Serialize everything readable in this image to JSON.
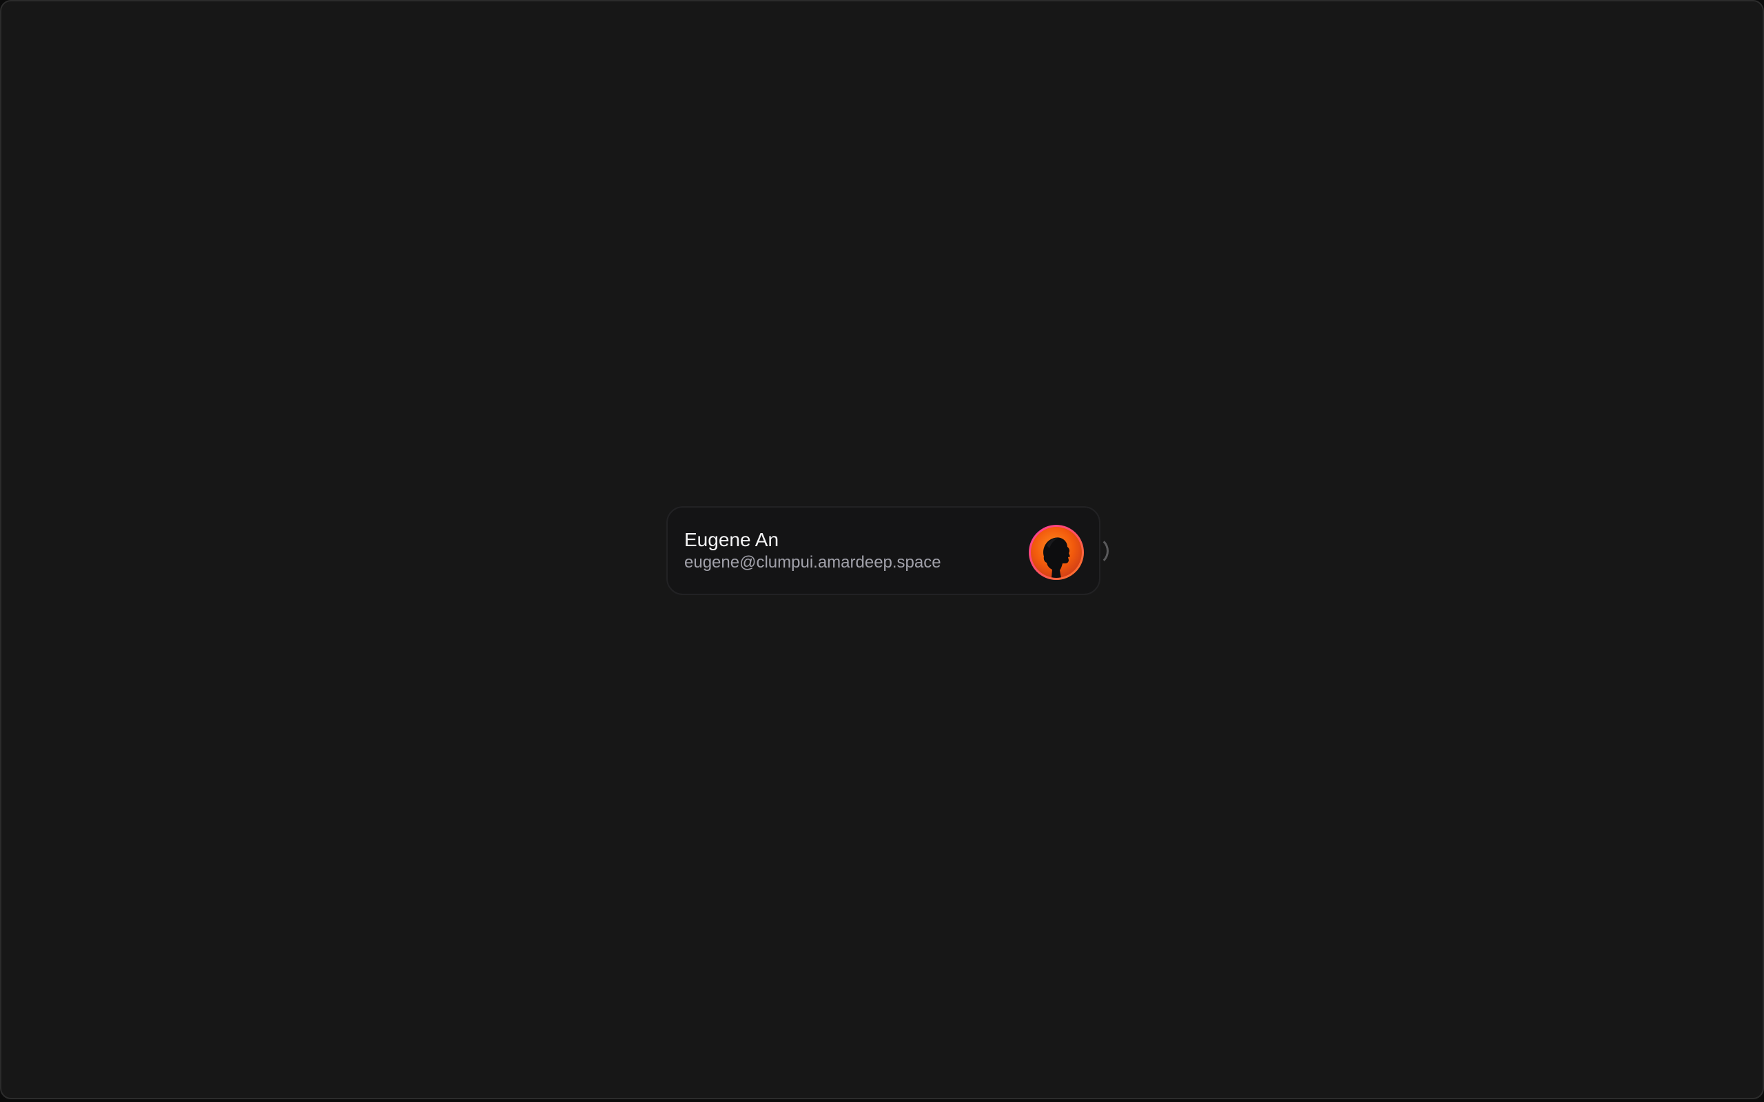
{
  "profile": {
    "name": "Eugene An",
    "email": "eugene@clumpui.amardeep.space",
    "avatar_icon": "person-silhouette-icon",
    "avatar_gradient": [
      "#ff3b9a",
      "#ff7a1a"
    ]
  },
  "colors": {
    "background": "#171717",
    "card_background": "#141415",
    "card_border": "#222224",
    "name_text": "#f4f4f5",
    "email_text": "#a1a1aa"
  }
}
